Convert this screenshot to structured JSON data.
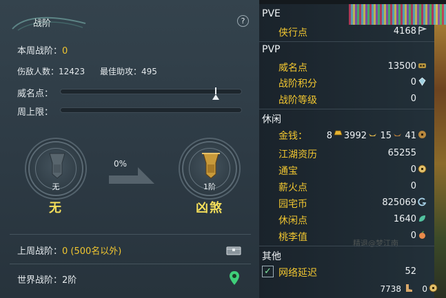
{
  "panel": {
    "title": "战阶",
    "help": "?",
    "weekly_rank_label": "本周战阶：",
    "weekly_rank_value": "0",
    "enemies_label": "伤敌人数：",
    "enemies_value": "12423",
    "best_assist_label": "最佳助攻：",
    "best_assist_value": "495",
    "prestige_label": "威名点：",
    "weekly_cap_label": "周上限：",
    "progress_percent_text": "0%",
    "current_rank": {
      "sub": "无",
      "name": "无"
    },
    "next_rank": {
      "sub": "1阶",
      "name": "凶煞"
    },
    "last_week_label": "上周战阶：",
    "last_week_value": "0 (500名以外)",
    "world_rank_label": "世界战阶：",
    "world_rank_value": "2阶"
  },
  "stats": {
    "pve": {
      "header": "PVE",
      "items": [
        {
          "label": "侠行点",
          "value": "4168",
          "icon": "flag-icon"
        }
      ]
    },
    "pvp": {
      "header": "PVP",
      "items": [
        {
          "label": "威名点",
          "value": "13500",
          "icon": "mask-icon"
        },
        {
          "label": "战阶积分",
          "value": "0",
          "icon": "crystal-icon"
        },
        {
          "label": "战阶等级",
          "value": "0"
        }
      ]
    },
    "leisure": {
      "header": "休闲",
      "money_label": "金钱：",
      "money_gold": "8",
      "money_silver": "3992",
      "money_copper": "15",
      "money_coin": "41",
      "items": [
        {
          "label": "江湖资历",
          "value": "65255"
        },
        {
          "label": "通宝",
          "value": "0",
          "icon": "coin-icon"
        },
        {
          "label": "薪火点",
          "value": "0"
        },
        {
          "label": "园宅币",
          "value": "825069",
          "icon": "house-coin-icon"
        },
        {
          "label": "休闲点",
          "value": "1640",
          "icon": "leaf-icon"
        },
        {
          "label": "桃李值",
          "value": "0",
          "icon": "peach-icon"
        }
      ]
    },
    "other": {
      "header": "其他",
      "latency_label": "网络延迟",
      "latency_value": "52"
    },
    "footer_value_1": "7738",
    "footer_value_2": "0"
  },
  "colors": {
    "accent_gold": "#f1c630",
    "rank_yellow": "#f4de5a"
  }
}
